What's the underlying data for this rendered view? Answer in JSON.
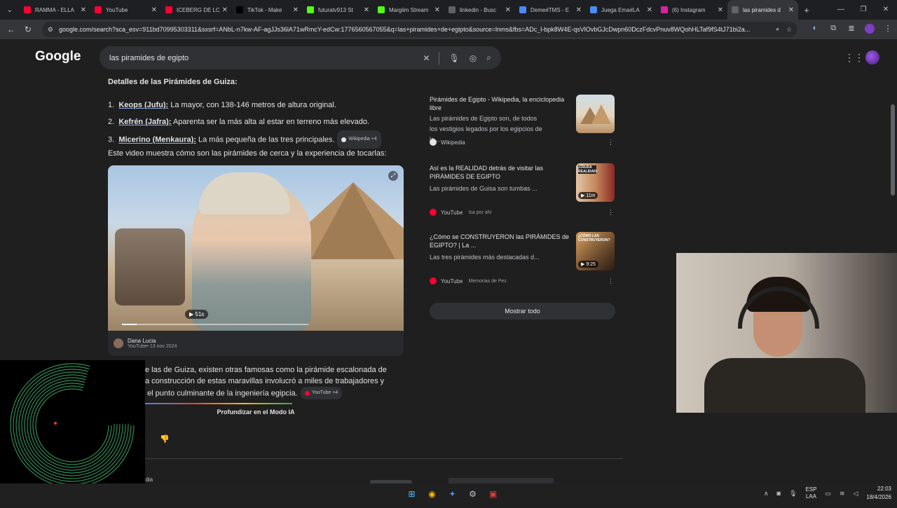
{
  "tabs": [
    {
      "label": "RAMMA - ELLA",
      "fav": "youtube-icon",
      "color": "#ff0033"
    },
    {
      "label": "YouTube",
      "fav": "youtube-icon",
      "color": "#ff0033"
    },
    {
      "label": "ICEBERG DE LO",
      "fav": "youtube-icon",
      "color": "#ff0033"
    },
    {
      "label": "TikTok - Make",
      "fav": "tiktok-icon",
      "color": "#000000"
    },
    {
      "label": "futuratv913 St",
      "fav": "kick-icon",
      "color": "#53fc18"
    },
    {
      "label": "Margiim Stream",
      "fav": "kick-icon",
      "color": "#53fc18"
    },
    {
      "label": "linkedin - Busc",
      "fav": "google-icon",
      "color": "#5f6368"
    },
    {
      "label": "Deme#TMS - E",
      "fav": "doc-icon",
      "color": "#4c8bf5"
    },
    {
      "label": "Juega Ema#LA",
      "fav": "google-icon",
      "color": "#4c8bf5"
    },
    {
      "label": "(6) Instagram",
      "fav": "instagram-icon",
      "color": "#d6249f"
    },
    {
      "label": "las piramides d",
      "fav": "google-icon",
      "color": "#5f6368"
    }
  ],
  "address": {
    "url": "google.com/search?sca_esv=911bd70995303311&sxsrf=ANbL-n7kw-AF-agJJs36lA71wRmcY-edCw:1776560567055&q=las+piramides+de+egipto&source=lnms&fbs=ADc_l-bpk8W4E-qsVlOvbGJcDwpn60DczFdcvPnuv8WQohHLTaf9fS4tJ71bi2a..."
  },
  "google": {
    "logo": "Google",
    "query": "las piramides de egipto"
  },
  "ai": {
    "heading": "Detalles de las Pirámides de Guiza:",
    "items": [
      {
        "num": "1.",
        "name": "Keops (Jufu):",
        "text": " La mayor, con 138-146 metros de altura original."
      },
      {
        "num": "2.",
        "name": "Kefrén (Jafra):",
        "text": " Aparenta ser la más alta al estar en terreno más elevado."
      },
      {
        "num": "3.",
        "name": "Micerino (Menkaura):",
        "text": " La más pequeña de las tres principales."
      }
    ],
    "chip1": "Wikipedia +4",
    "video_intro": "Este video muestra cómo son las pirámides de cerca y la experiencia de tocarlas:",
    "video": {
      "duration": "51s",
      "channel": "Dana Lucia",
      "meta": "YouTube• 13 nov 2024"
    },
    "para_l1": "e las de Guiza, existen otras famosas como la pirámide escalonada de",
    "para_l2": "a construcción de estas maravillas involucró a miles de trabajadores y",
    "para_l3": "el punto culminante de la ingeniería egipcia.",
    "chip2": "YouTube +4",
    "deep_dive": "Profundizar en el Modo IA",
    "tail": "edia"
  },
  "side": [
    {
      "title": "Pirámides de Egipto - Wikipedia, la enciclopedia libre",
      "desc": "Las pirámides de Egipto son, de todos los vestigios legados por los egipcios de la...",
      "source": "Wikipedia",
      "sub": "",
      "src_color": "#e3e3e3"
    },
    {
      "title": "Así es la REALIDAD detrás de visitar las PIRÁMIDES DE EGIPTO",
      "desc": "Las pirámides de Guisa son tumbas ...",
      "source": "YouTube",
      "sub": "Isa por ahí",
      "src_color": "#ff0033",
      "thumb_label": "¡CRUDA REALIDAD!",
      "duration": "11m"
    },
    {
      "title": "¿Cómo se CONSTRUYERON las PIRÁMIDES de EGIPTO? | La ...",
      "desc": "Las tres pirámides más destacadas d...",
      "source": "YouTube",
      "sub": "Memorias de Pez",
      "src_color": "#ff0033",
      "thumb_label": "¿CÓMO LAS CONSTRUYERON?",
      "duration": "9:25"
    }
  ],
  "show_all": "Mostrar todo",
  "taskbar": {
    "lang1": "ESP",
    "lang2": "LAA",
    "time": "22:03",
    "date": "18/4/2026"
  }
}
